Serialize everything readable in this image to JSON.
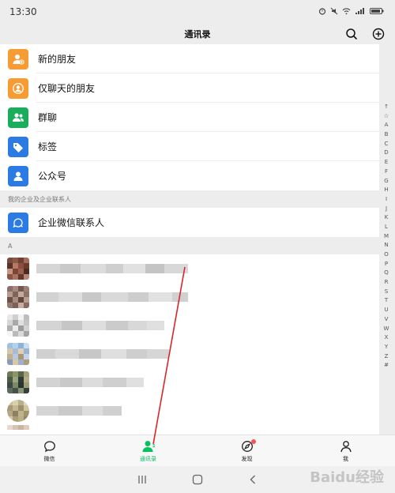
{
  "status_bar": {
    "time": "13:30"
  },
  "header": {
    "title": "通讯录"
  },
  "functions": [
    {
      "label": "新的朋友",
      "color": "#f79c32",
      "icon": "add-friend-icon"
    },
    {
      "label": "仅聊天的朋友",
      "color": "#f79c32",
      "icon": "chat-only-friend-icon"
    },
    {
      "label": "群聊",
      "color": "#1aad5c",
      "icon": "group-chat-icon"
    },
    {
      "label": "标签",
      "color": "#2c7be5",
      "icon": "tag-icon"
    },
    {
      "label": "公众号",
      "color": "#2c7be5",
      "icon": "official-account-icon"
    }
  ],
  "enterprise": {
    "header": "我的企业及企业联系人",
    "item": {
      "label": "企业微信联系人",
      "color": "#2c7be5",
      "icon": "enterprise-contact-icon"
    }
  },
  "contacts_section": {
    "letter": "A"
  },
  "index_letters": [
    "↑",
    "☆",
    "A",
    "B",
    "C",
    "D",
    "E",
    "F",
    "G",
    "H",
    "I",
    "J",
    "K",
    "L",
    "M",
    "N",
    "O",
    "P",
    "Q",
    "R",
    "S",
    "T",
    "U",
    "V",
    "W",
    "X",
    "Y",
    "Z",
    "#"
  ],
  "tabs": [
    {
      "label": "微信",
      "icon": "chat-bubble-icon",
      "active": false
    },
    {
      "label": "通讯录",
      "icon": "contacts-icon",
      "active": true
    },
    {
      "label": "发现",
      "icon": "compass-icon",
      "active": false
    },
    {
      "label": "我",
      "icon": "person-icon",
      "active": false
    }
  ],
  "colors": {
    "accent": "#07c160",
    "badge": "#fa5151",
    "annotation_line": "#d9262b"
  },
  "watermark": "Baidu经验"
}
